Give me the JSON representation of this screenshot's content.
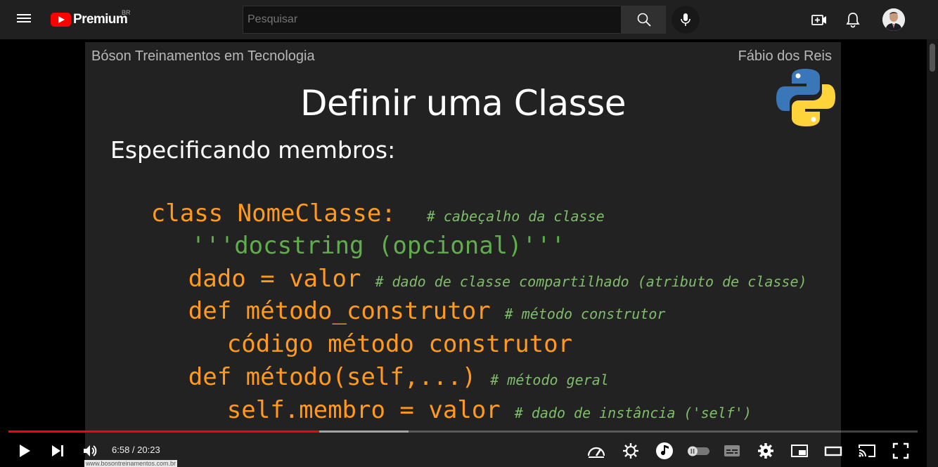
{
  "masthead": {
    "logo_text": "Premium",
    "country_code": "BR",
    "search_placeholder": "Pesquisar"
  },
  "slide": {
    "organization": "Bóson Treinamentos em Tecnologia",
    "author": "Fábio dos Reis",
    "title": "Definir uma Classe",
    "subtitle": "Especificando membros:",
    "code": [
      {
        "code": "class NomeClasse:",
        "comment": "# cabeçalho da classe"
      },
      {
        "code": "'''docstring (opcional)'''",
        "comment": ""
      },
      {
        "code": "dado = valor",
        "comment": "# dado de classe compartilhado (atributo de classe)"
      },
      {
        "code": "def método_construtor",
        "comment": "# método construtor"
      },
      {
        "code": "código método construtor",
        "comment": ""
      },
      {
        "code": "def método(self,...)",
        "comment": "# método geral"
      },
      {
        "code": "self.membro = valor",
        "comment": "# dado de instância ('self')"
      }
    ],
    "watermark": "www.bosontreinamentos.com.br"
  },
  "player": {
    "current_time": "6:58",
    "duration": "20:23",
    "time_display": "6:58 / 20:23",
    "played_fraction": 0.342,
    "loaded_fraction": 0.44
  },
  "colors": {
    "code": "#ff9a1c",
    "docstring": "#5fae4b",
    "comment": "#7fbd6b",
    "progress": "#ff0000"
  }
}
